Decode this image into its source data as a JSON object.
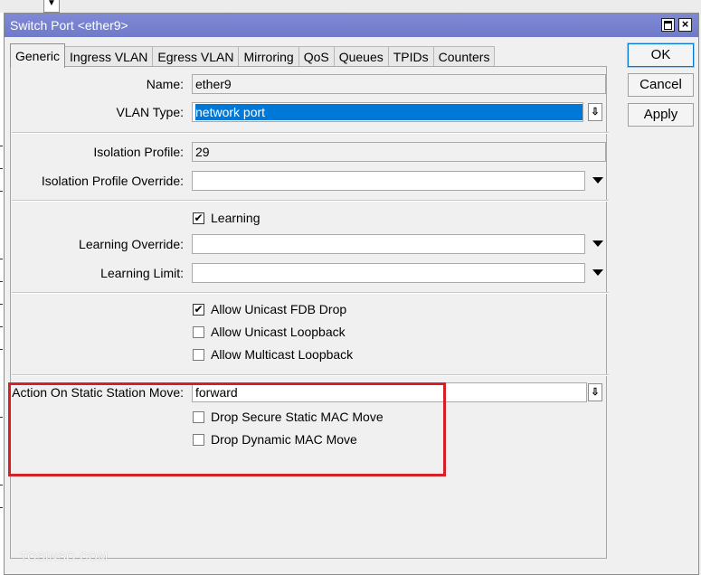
{
  "window": {
    "title": "Switch Port <ether9>"
  },
  "tabs": [
    "Generic",
    "Ingress VLAN",
    "Egress VLAN",
    "Mirroring",
    "QoS",
    "Queues",
    "TPIDs",
    "Counters"
  ],
  "buttons": {
    "ok": "OK",
    "cancel": "Cancel",
    "apply": "Apply"
  },
  "fields": {
    "name": {
      "label": "Name:",
      "value": "ether9"
    },
    "vlan_type": {
      "label": "VLAN Type:",
      "value": "network port"
    },
    "isolation_profile": {
      "label": "Isolation Profile:",
      "value": "29"
    },
    "isolation_profile_override": {
      "label": "Isolation Profile Override:",
      "value": ""
    },
    "learning_override": {
      "label": "Learning Override:",
      "value": ""
    },
    "learning_limit": {
      "label": "Learning Limit:",
      "value": ""
    },
    "action_on_static_station_move": {
      "label": "Action On Static Station Move:",
      "value": "forward"
    }
  },
  "checkboxes": {
    "learning": {
      "label": "Learning",
      "checked": true
    },
    "allow_unicast_fdb_drop": {
      "label": "Allow Unicast FDB Drop",
      "checked": true
    },
    "allow_unicast_loopback": {
      "label": "Allow Unicast Loopback",
      "checked": false
    },
    "allow_multicast_loopback": {
      "label": "Allow Multicast Loopback",
      "checked": false
    },
    "drop_secure_static_mac_move": {
      "label": "Drop Secure Static MAC Move",
      "checked": false
    },
    "drop_dynamic_mac_move": {
      "label": "Drop Dynamic MAC Move",
      "checked": false
    }
  },
  "watermark": "TOSINSO.COM",
  "colors": {
    "titlebar": "#7480cf",
    "selection": "#0078d7",
    "highlight_box": "#d42026"
  }
}
